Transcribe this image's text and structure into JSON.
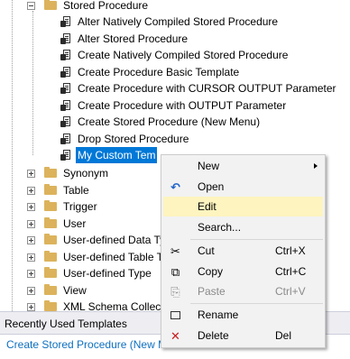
{
  "tree": {
    "stored_procedure": "Stored Procedure",
    "templates": [
      "Alter Natively Compiled Stored Procedure",
      "Alter Stored Procedure",
      "Create Natively Compiled Stored Procedure",
      "Create Procedure Basic Template",
      "Create Procedure with CURSOR OUTPUT Parameter",
      "Create Procedure with OUTPUT Parameter",
      "Create Stored Procedure (New Menu)",
      "Drop Stored Procedure",
      "My Custom Tem"
    ],
    "folders": [
      "Synonym",
      "Table",
      "Trigger",
      "User",
      "User-defined Data Ty",
      "User-defined Table T",
      "User-defined Type",
      "View",
      "XML Schema Collect"
    ]
  },
  "panel": {
    "title": "Recently Used Templates",
    "recent_item": "Create Stored Procedure (New M"
  },
  "context_menu": {
    "new": "New",
    "open": "Open",
    "edit": "Edit",
    "search": "Search...",
    "cut": "Cut",
    "cut_shortcut": "Ctrl+X",
    "copy": "Copy",
    "copy_shortcut": "Ctrl+C",
    "paste": "Paste",
    "paste_shortcut": "Ctrl+V",
    "rename": "Rename",
    "delete": "Delete",
    "delete_shortcut": "Del"
  },
  "icons": {
    "folder": "folder-icon",
    "template": "template-file-icon",
    "open": "open-icon",
    "cut": "scissors-icon",
    "copy": "copy-icon",
    "paste": "paste-icon",
    "rename": "rename-icon",
    "delete": "delete-icon"
  },
  "colors": {
    "selection": "#0078d7",
    "menu_highlight": "#fdf4bf",
    "folder": "#dcb35c",
    "link": "#0e70c0"
  }
}
